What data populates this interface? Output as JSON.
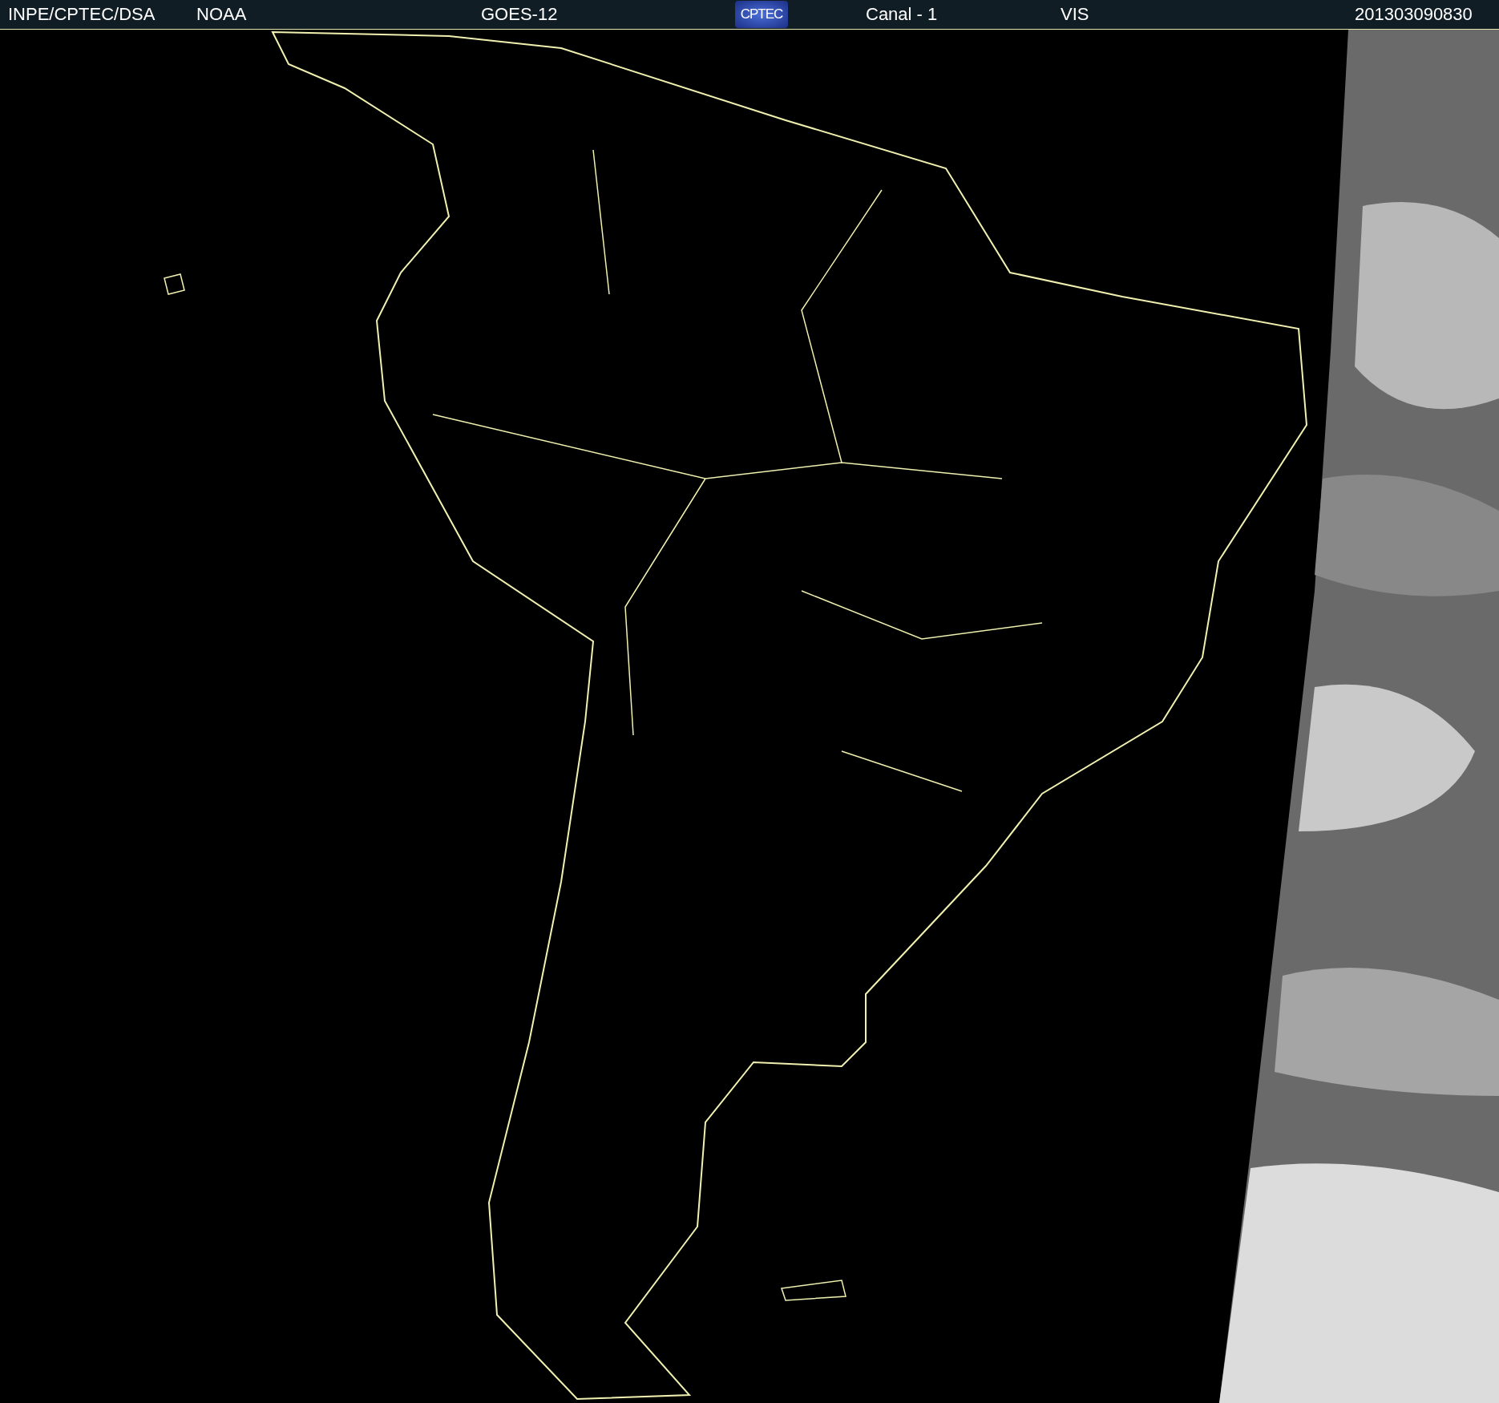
{
  "header": {
    "source": "INPE/CPTEC/DSA",
    "agency": "NOAA",
    "satellite": "GOES-12",
    "logo_text": "CPTEC",
    "channel": "Canal - 1",
    "band": "VIS",
    "timestamp": "201303090830"
  }
}
